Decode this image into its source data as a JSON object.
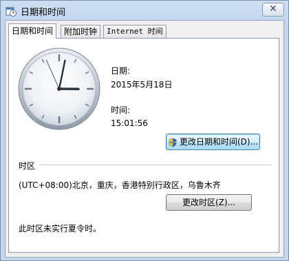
{
  "window": {
    "title": "日期和时间",
    "close_glyph": "✕"
  },
  "tabs": [
    {
      "label": "日期和时间",
      "active": true
    },
    {
      "label": "附加时钟",
      "active": false
    },
    {
      "label": "Internet 时间",
      "active": false
    }
  ],
  "datetime": {
    "date_label": "日期:",
    "date_value": "2015年5月18日",
    "time_label": "时间:",
    "time_value": "15:01:56",
    "change_button": "更改日期和时间(D)..."
  },
  "timezone": {
    "section_label": "时区",
    "value": "(UTC+08:00)北京，重庆，香港特别行政区，乌鲁木齐",
    "change_button": "更改时区(Z)...",
    "dst_note": "此时区未实行夏令时。"
  },
  "clock": {
    "hour": 15,
    "minute": 1,
    "second": 56
  },
  "icons": {
    "title": "calendar-clock-icon",
    "uac": "uac-shield-icon",
    "close": "close-icon"
  },
  "colors": {
    "title_gradient": "#c2d6ee",
    "accent": "#3c7fb1"
  }
}
